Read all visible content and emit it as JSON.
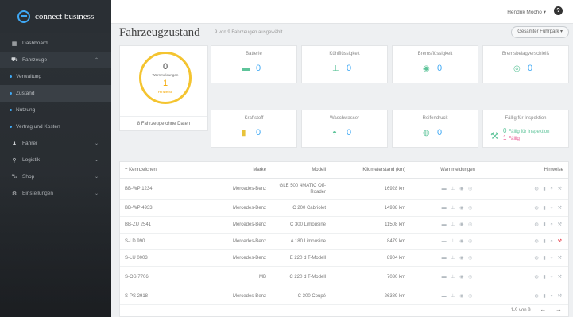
{
  "app": {
    "name": "connect business"
  },
  "sidebar": {
    "items": [
      {
        "label": "Dashboard",
        "icon": "grid-icon",
        "type": "top"
      },
      {
        "label": "Fahrzeuge",
        "icon": "car-icon",
        "type": "top"
      },
      {
        "label": "Verwaltung",
        "icon": "dot",
        "type": "sub"
      },
      {
        "label": "Zustand",
        "icon": "dot",
        "type": "sub"
      },
      {
        "label": "Nutzung",
        "icon": "dot",
        "type": "sub"
      },
      {
        "label": "Vertrag und Kosten",
        "icon": "dot",
        "type": "sub"
      },
      {
        "label": "Fahrer",
        "icon": "person-icon",
        "type": "top"
      },
      {
        "label": "Logistik",
        "icon": "pin-icon",
        "type": "top"
      },
      {
        "label": "Shop",
        "icon": "cart-icon",
        "type": "top"
      },
      {
        "label": "Einstellungen",
        "icon": "gear-icon",
        "type": "top"
      }
    ]
  },
  "topbar": {
    "user": "Hendrik Mocho ▾",
    "help": "?"
  },
  "header": {
    "title": "Fahrzeugzustand",
    "subtitle": "9 von 9 Fahrzeugen ausgewählt",
    "fleet_button": "Gesamter Fuhrpark ▾"
  },
  "summary": {
    "warnings_count": "0",
    "warnings_label": "Warnmeldungen",
    "notes_count": "1",
    "notes_label": "Hinweise",
    "no_data": "8 Fahrzeuge ohne Daten"
  },
  "tiles": [
    {
      "label": "Batterie",
      "value": "0",
      "icon": "battery-icon"
    },
    {
      "label": "Kühlflüssigkeit",
      "value": "0",
      "icon": "coolant-icon"
    },
    {
      "label": "Bremsflüssigkeit",
      "value": "0",
      "icon": "brake-fluid-icon"
    },
    {
      "label": "Bremsbelagverschleiß",
      "value": "0",
      "icon": "brake-pad-icon"
    },
    {
      "label": "Kraftstoff",
      "value": "0",
      "icon": "fuel-icon"
    },
    {
      "label": "Waschwasser",
      "value": "0",
      "icon": "washer-icon"
    },
    {
      "label": "Reifendruck",
      "value": "0",
      "icon": "tire-icon"
    }
  ],
  "inspection": {
    "label": "Fällig für Inspektion",
    "due_count": "0",
    "due_text": "Fällig für Inspektion",
    "overdue_count": "1",
    "overdue_text": "Fällig"
  },
  "table": {
    "headers": {
      "plate": "+ Kennzeichen",
      "brand": "Marke",
      "model": "Modell",
      "km": "Kilometerstand (km)",
      "warnings": "Warnmeldungen",
      "notes": "Hinweise"
    },
    "rows": [
      {
        "plate": "BB-WP 1234",
        "brand": "Mercedes-Benz",
        "model": "GLE 500 4MATIC Off-Roader",
        "km": "16928 km",
        "red": false,
        "tall": true
      },
      {
        "plate": "BB-WP 4933",
        "brand": "Mercedes-Benz",
        "model": "C 200 Cabriolet",
        "km": "14938 km",
        "red": false,
        "tall": false
      },
      {
        "plate": "BB-ZU 2541",
        "brand": "Mercedes-Benz",
        "model": "C 300 Limousine",
        "km": "11508 km",
        "red": false,
        "tall": false
      },
      {
        "plate": "S-LD 990",
        "brand": "Mercedes-Benz",
        "model": "A 180 Limousine",
        "km": "8479 km",
        "red": true,
        "tall": false
      },
      {
        "plate": "S-LU 0003",
        "brand": "Mercedes-Benz",
        "model": "E 220 d T-Modell",
        "km": "8904 km",
        "red": false,
        "tall": false
      },
      {
        "plate": "S-OS 7706",
        "brand": "MB",
        "model": "C 220 d T-Modell",
        "km": "7030 km",
        "red": false,
        "tall": true
      },
      {
        "plate": "S-PS 2918",
        "brand": "Mercedes-Benz",
        "model": "C 300 Coupé",
        "km": "26389 km",
        "red": false,
        "tall": false
      }
    ],
    "pagination": "1-9 von 9"
  }
}
